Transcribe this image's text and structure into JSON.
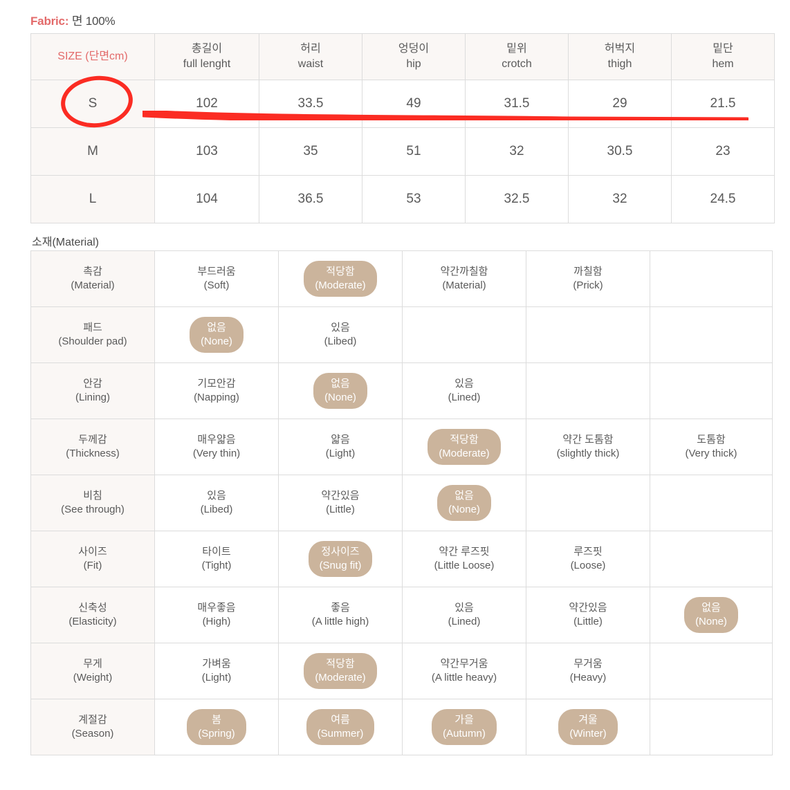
{
  "fabric": {
    "label": "Fabric:",
    "value": "면 100%"
  },
  "size_table": {
    "headers": [
      {
        "kr": "SIZE (단면cm)",
        "en": ""
      },
      {
        "kr": "총길이",
        "en": "full lenght"
      },
      {
        "kr": "허리",
        "en": "waist"
      },
      {
        "kr": "엉덩이",
        "en": "hip"
      },
      {
        "kr": "밑위",
        "en": "crotch"
      },
      {
        "kr": "허벅지",
        "en": "thigh"
      },
      {
        "kr": "밑단",
        "en": "hem"
      }
    ],
    "rows": [
      {
        "size": "S",
        "full_length": "102",
        "waist": "33.5",
        "hip": "49",
        "crotch": "31.5",
        "thigh": "29",
        "hem": "21.5"
      },
      {
        "size": "M",
        "full_length": "103",
        "waist": "35",
        "hip": "51",
        "crotch": "32",
        "thigh": "30.5",
        "hem": "23"
      },
      {
        "size": "L",
        "full_length": "104",
        "waist": "36.5",
        "hip": "53",
        "crotch": "32.5",
        "thigh": "32",
        "hem": "24.5"
      }
    ]
  },
  "material_heading": "소재(Material)",
  "material_table": {
    "rows": [
      {
        "label": {
          "kr": "촉감",
          "en": "(Material)"
        },
        "cells": [
          {
            "kr": "부드러움",
            "en": "(Soft)",
            "selected": false
          },
          {
            "kr": "적당함",
            "en": "(Moderate)",
            "selected": true
          },
          {
            "kr": "약간까칠함",
            "en": "(Material)",
            "selected": false
          },
          {
            "kr": "까칠함",
            "en": "(Prick)",
            "selected": false
          },
          {
            "kr": "",
            "en": "",
            "selected": false
          }
        ]
      },
      {
        "label": {
          "kr": "패드",
          "en": "(Shoulder pad)"
        },
        "cells": [
          {
            "kr": "없음",
            "en": "(None)",
            "selected": true
          },
          {
            "kr": "있음",
            "en": "(Libed)",
            "selected": false
          },
          {
            "kr": "",
            "en": "",
            "selected": false
          },
          {
            "kr": "",
            "en": "",
            "selected": false
          },
          {
            "kr": "",
            "en": "",
            "selected": false
          }
        ]
      },
      {
        "label": {
          "kr": "안감",
          "en": "(Lining)"
        },
        "cells": [
          {
            "kr": "기모안감",
            "en": "(Napping)",
            "selected": false
          },
          {
            "kr": "없음",
            "en": "(None)",
            "selected": true
          },
          {
            "kr": "있음",
            "en": "(Lined)",
            "selected": false
          },
          {
            "kr": "",
            "en": "",
            "selected": false
          },
          {
            "kr": "",
            "en": "",
            "selected": false
          }
        ]
      },
      {
        "label": {
          "kr": "두께감",
          "en": "(Thickness)"
        },
        "cells": [
          {
            "kr": "매우얇음",
            "en": "(Very thin)",
            "selected": false
          },
          {
            "kr": "얇음",
            "en": "(Light)",
            "selected": false
          },
          {
            "kr": "적당함",
            "en": "(Moderate)",
            "selected": true
          },
          {
            "kr": "약간 도톰함",
            "en": "(slightly thick)",
            "selected": false
          },
          {
            "kr": "도톰함",
            "en": "(Very thick)",
            "selected": false
          }
        ]
      },
      {
        "label": {
          "kr": "비침",
          "en": "(See through)"
        },
        "cells": [
          {
            "kr": "있음",
            "en": "(Libed)",
            "selected": false
          },
          {
            "kr": "약간있음",
            "en": "(Little)",
            "selected": false
          },
          {
            "kr": "없음",
            "en": "(None)",
            "selected": true
          },
          {
            "kr": "",
            "en": "",
            "selected": false
          },
          {
            "kr": "",
            "en": "",
            "selected": false
          }
        ]
      },
      {
        "label": {
          "kr": "사이즈",
          "en": "(Fit)"
        },
        "cells": [
          {
            "kr": "타이트",
            "en": "(Tight)",
            "selected": false
          },
          {
            "kr": "정사이즈",
            "en": "(Snug fit)",
            "selected": true
          },
          {
            "kr": "약간 루즈핏",
            "en": "(Little Loose)",
            "selected": false
          },
          {
            "kr": "루즈핏",
            "en": "(Loose)",
            "selected": false
          },
          {
            "kr": "",
            "en": "",
            "selected": false
          }
        ]
      },
      {
        "label": {
          "kr": "신축성",
          "en": "(Elasticity)"
        },
        "cells": [
          {
            "kr": "매우좋음",
            "en": "(High)",
            "selected": false
          },
          {
            "kr": "좋음",
            "en": "(A little high)",
            "selected": false
          },
          {
            "kr": "있음",
            "en": "(Lined)",
            "selected": false
          },
          {
            "kr": "약간있음",
            "en": "(Little)",
            "selected": false
          },
          {
            "kr": "없음",
            "en": "(None)",
            "selected": true
          }
        ]
      },
      {
        "label": {
          "kr": "무게",
          "en": "(Weight)"
        },
        "cells": [
          {
            "kr": "가벼움",
            "en": "(Light)",
            "selected": false
          },
          {
            "kr": "적당함",
            "en": "(Moderate)",
            "selected": true
          },
          {
            "kr": "약간무거움",
            "en": "(A little heavy)",
            "selected": false
          },
          {
            "kr": "무거움",
            "en": "(Heavy)",
            "selected": false
          },
          {
            "kr": "",
            "en": "",
            "selected": false
          }
        ]
      },
      {
        "label": {
          "kr": "계절감",
          "en": "(Season)"
        },
        "cells": [
          {
            "kr": "봄",
            "en": "(Spring)",
            "selected": true
          },
          {
            "kr": "여름",
            "en": "(Summer)",
            "selected": true
          },
          {
            "kr": "가을",
            "en": "(Autumn)",
            "selected": true
          },
          {
            "kr": "겨울",
            "en": "(Winter)",
            "selected": true
          },
          {
            "kr": "",
            "en": "",
            "selected": false
          }
        ]
      }
    ]
  },
  "annotations": {
    "circle_target": "S",
    "color": "#fb2c23"
  }
}
